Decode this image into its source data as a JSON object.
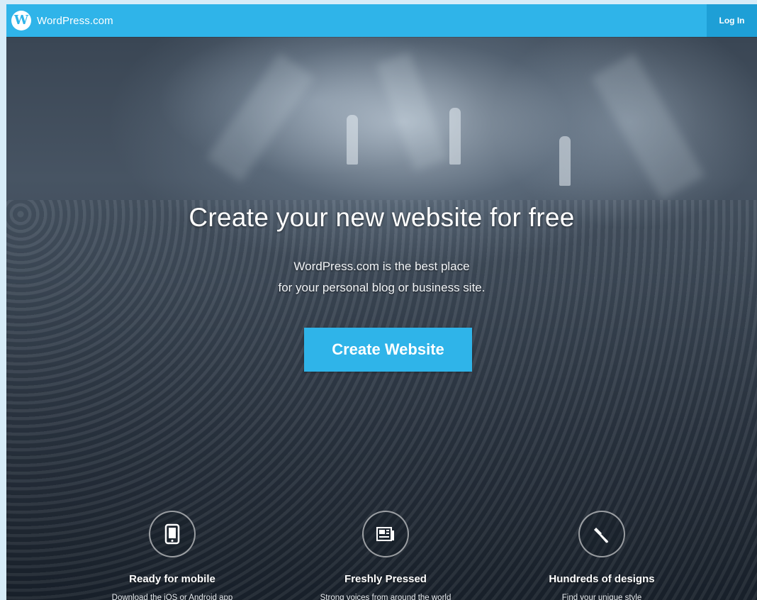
{
  "header": {
    "logo_letter": "W",
    "brand_name": "WordPress.com",
    "login_label": "Log In"
  },
  "hero": {
    "headline": "Create your new website for free",
    "subhead_line1": "WordPress.com is the best place",
    "subhead_line2": "for your personal blog or business site.",
    "cta_label": "Create Website"
  },
  "features": [
    {
      "icon": "mobile-device-icon",
      "title": "Ready for mobile",
      "description": "Download the iOS or Android app"
    },
    {
      "icon": "freshly-pressed-icon",
      "title": "Freshly Pressed",
      "description": "Strong voices from around the world"
    },
    {
      "icon": "paintbrush-icon",
      "title": "Hundreds of designs",
      "description": "Find your unique style"
    }
  ],
  "colors": {
    "accent": "#2fb4e9",
    "login_bg": "#1e9fd6",
    "page_bg": "#d7ecf8"
  }
}
